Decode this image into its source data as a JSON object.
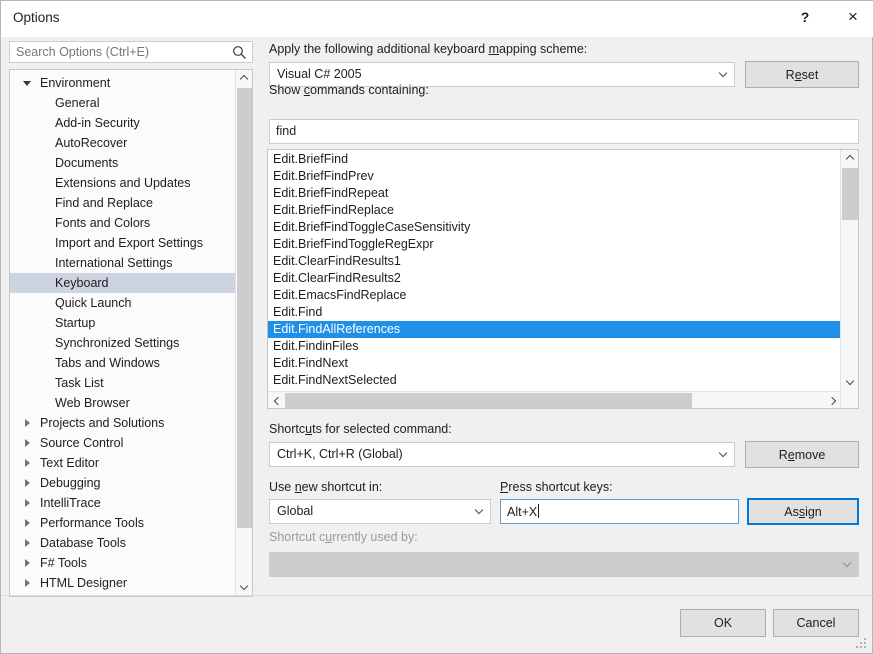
{
  "window": {
    "title": "Options",
    "help_label": "?",
    "close_label": "×"
  },
  "search": {
    "placeholder": "Search Options (Ctrl+E)",
    "value": "",
    "icon": "search-icon"
  },
  "tree": {
    "items": [
      {
        "label": "Environment",
        "level": 0,
        "state": "expanded",
        "selected": false
      },
      {
        "label": "General",
        "level": 1,
        "state": "leaf",
        "selected": false
      },
      {
        "label": "Add-in Security",
        "level": 1,
        "state": "leaf",
        "selected": false
      },
      {
        "label": "AutoRecover",
        "level": 1,
        "state": "leaf",
        "selected": false
      },
      {
        "label": "Documents",
        "level": 1,
        "state": "leaf",
        "selected": false
      },
      {
        "label": "Extensions and Updates",
        "level": 1,
        "state": "leaf",
        "selected": false
      },
      {
        "label": "Find and Replace",
        "level": 1,
        "state": "leaf",
        "selected": false
      },
      {
        "label": "Fonts and Colors",
        "level": 1,
        "state": "leaf",
        "selected": false
      },
      {
        "label": "Import and Export Settings",
        "level": 1,
        "state": "leaf",
        "selected": false
      },
      {
        "label": "International Settings",
        "level": 1,
        "state": "leaf",
        "selected": false
      },
      {
        "label": "Keyboard",
        "level": 1,
        "state": "leaf",
        "selected": true
      },
      {
        "label": "Quick Launch",
        "level": 1,
        "state": "leaf",
        "selected": false
      },
      {
        "label": "Startup",
        "level": 1,
        "state": "leaf",
        "selected": false
      },
      {
        "label": "Synchronized Settings",
        "level": 1,
        "state": "leaf",
        "selected": false
      },
      {
        "label": "Tabs and Windows",
        "level": 1,
        "state": "leaf",
        "selected": false
      },
      {
        "label": "Task List",
        "level": 1,
        "state": "leaf",
        "selected": false
      },
      {
        "label": "Web Browser",
        "level": 1,
        "state": "leaf",
        "selected": false
      },
      {
        "label": "Projects and Solutions",
        "level": 0,
        "state": "collapsed",
        "selected": false
      },
      {
        "label": "Source Control",
        "level": 0,
        "state": "collapsed",
        "selected": false
      },
      {
        "label": "Text Editor",
        "level": 0,
        "state": "collapsed",
        "selected": false
      },
      {
        "label": "Debugging",
        "level": 0,
        "state": "collapsed",
        "selected": false
      },
      {
        "label": "IntelliTrace",
        "level": 0,
        "state": "collapsed",
        "selected": false
      },
      {
        "label": "Performance Tools",
        "level": 0,
        "state": "collapsed",
        "selected": false
      },
      {
        "label": "Database Tools",
        "level": 0,
        "state": "collapsed",
        "selected": false
      },
      {
        "label": "F# Tools",
        "level": 0,
        "state": "collapsed",
        "selected": false
      },
      {
        "label": "HTML Designer",
        "level": 0,
        "state": "collapsed",
        "selected": false
      }
    ]
  },
  "keyboard_page": {
    "scheme_label_pre": "Apply the following additional keyboard ",
    "scheme_label_mnemonic": "m",
    "scheme_label_post": "apping scheme:",
    "scheme_value": "Visual C# 2005",
    "reset_label_pre": "R",
    "reset_label_mnemonic": "e",
    "reset_label_post": "set",
    "reset_label": "Reset",
    "filter_label_pre": "Show ",
    "filter_label_mnemonic": "c",
    "filter_label_post": "ommands containing:",
    "filter_value": "find",
    "commands": [
      "Edit.BriefFind",
      "Edit.BriefFindPrev",
      "Edit.BriefFindRepeat",
      "Edit.BriefFindReplace",
      "Edit.BriefFindToggleCaseSensitivity",
      "Edit.BriefFindToggleRegExpr",
      "Edit.ClearFindResults1",
      "Edit.ClearFindResults2",
      "Edit.EmacsFindReplace",
      "Edit.Find",
      "Edit.FindAllReferences",
      "Edit.FindinFiles",
      "Edit.FindNext",
      "Edit.FindNextSelected"
    ],
    "selected_command": "Edit.FindAllReferences",
    "selected_command_index": 10,
    "shortcuts_label_pre": "Shortc",
    "shortcuts_label_mnemonic": "u",
    "shortcuts_label_post": "ts for selected command:",
    "shortcuts_value": "Ctrl+K, Ctrl+R (Global)",
    "remove_label_pre": "R",
    "remove_label_mnemonic": "e",
    "remove_label_post": "move",
    "remove_label": "Remove",
    "scope_label_pre": "Use ",
    "scope_label_mnemonic": "n",
    "scope_label_post": "ew shortcut in:",
    "scope_value": "Global",
    "press_label_pre": "",
    "press_label_mnemonic": "P",
    "press_label_post": "ress shortcut keys:",
    "press_value": "Alt+X",
    "assign_label_pre": "As",
    "assign_label_mnemonic": "s",
    "assign_label_post": "ign",
    "assign_label": "Assign",
    "used_by_label_pre": "Shortcut c",
    "used_by_label_mnemonic": "u",
    "used_by_label_post": "rrently used by:",
    "used_by_value": ""
  },
  "footer": {
    "ok_label": "OK",
    "cancel_label": "Cancel"
  },
  "colors": {
    "selection_blue": "#1e90e8",
    "inactive_selection": "#cdd3e0",
    "focus_blue": "#0078d7",
    "dialog_bg": "#f0f0f0"
  }
}
